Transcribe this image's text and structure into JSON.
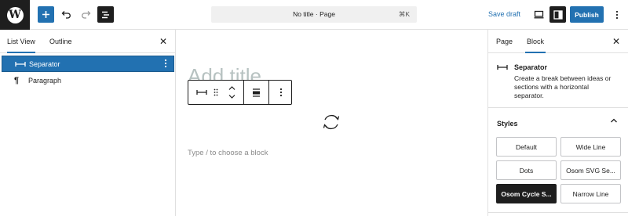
{
  "topbar": {
    "logo_letter": "W",
    "document_title": "No title · Page",
    "shortcut": "⌘K",
    "save_draft": "Save draft",
    "publish": "Publish"
  },
  "left_panel": {
    "tabs": [
      {
        "label": "List View",
        "active": true
      },
      {
        "label": "Outline",
        "active": false
      }
    ],
    "items": [
      {
        "label": "Separator",
        "selected": true
      },
      {
        "label": "Paragraph",
        "selected": false
      }
    ]
  },
  "canvas": {
    "title_placeholder": "Add title",
    "appender_placeholder": "Type / to choose a block"
  },
  "sidebar": {
    "tabs": [
      {
        "label": "Page",
        "active": false
      },
      {
        "label": "Block",
        "active": true
      }
    ],
    "block": {
      "name": "Separator",
      "description": "Create a break between ideas or sections with a horizontal separator."
    },
    "styles_heading": "Styles",
    "styles": [
      {
        "label": "Default",
        "active": false
      },
      {
        "label": "Wide Line",
        "active": false
      },
      {
        "label": "Dots",
        "active": false
      },
      {
        "label": "Osom SVG Se...",
        "active": false
      },
      {
        "label": "Osom Cycle S...",
        "active": true
      },
      {
        "label": "Narrow Line",
        "active": false
      }
    ]
  },
  "colors": {
    "accent": "#2271b1",
    "dark": "#1e1e1e",
    "border": "#e0e0e0"
  }
}
